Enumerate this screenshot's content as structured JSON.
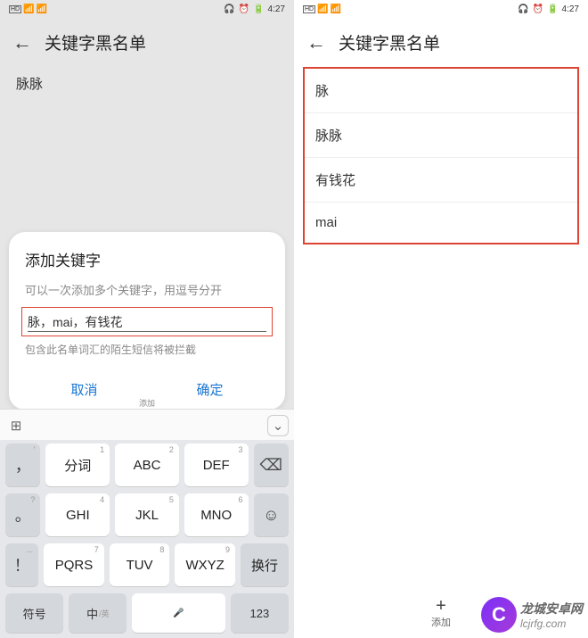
{
  "status": {
    "time": "4:27",
    "hd_label": "HD"
  },
  "left": {
    "header_title": "关键字黑名单",
    "existing_keyword": "脉脉",
    "dialog": {
      "title": "添加关键字",
      "subtitle": "可以一次添加多个关键字，用逗号分开",
      "input_value": "脉，mai，有钱花",
      "hint": "包含此名单词汇的陌生短信将被拦截",
      "cancel": "取消",
      "confirm": "确定"
    },
    "add_hint": "添加",
    "keyboard": {
      "row1": [
        {
          "main": "，",
          "sub": "'",
          "narrow": true
        },
        {
          "main": "分词",
          "sub": "1"
        },
        {
          "main": "ABC",
          "sub": "2"
        },
        {
          "main": "DEF",
          "sub": "3"
        }
      ],
      "row2": [
        {
          "main": "。",
          "sub": "?",
          "narrow": true
        },
        {
          "main": "GHI",
          "sub": "4"
        },
        {
          "main": "JKL",
          "sub": "5"
        },
        {
          "main": "MNO",
          "sub": "6"
        }
      ],
      "row3": [
        {
          "main": "！",
          "sub": "...",
          "narrow": true
        },
        {
          "main": "PQRS",
          "sub": "7"
        },
        {
          "main": "TUV",
          "sub": "8"
        },
        {
          "main": "WXYZ",
          "sub": "9"
        }
      ],
      "backspace": "⌫",
      "emoji": "☺",
      "enter": "换行",
      "bottom": {
        "symbol": "符号",
        "lang_main": "中",
        "lang_sub": "/英",
        "mic": "🎤",
        "num": "123"
      }
    }
  },
  "right": {
    "header_title": "关键字黑名单",
    "list": [
      "脉",
      "脉脉",
      "有钱花",
      "mai"
    ],
    "add_label": "添加"
  },
  "watermark": {
    "logo": "C",
    "main": "龙城安卓网",
    "sub": "lcjrfg.com"
  }
}
